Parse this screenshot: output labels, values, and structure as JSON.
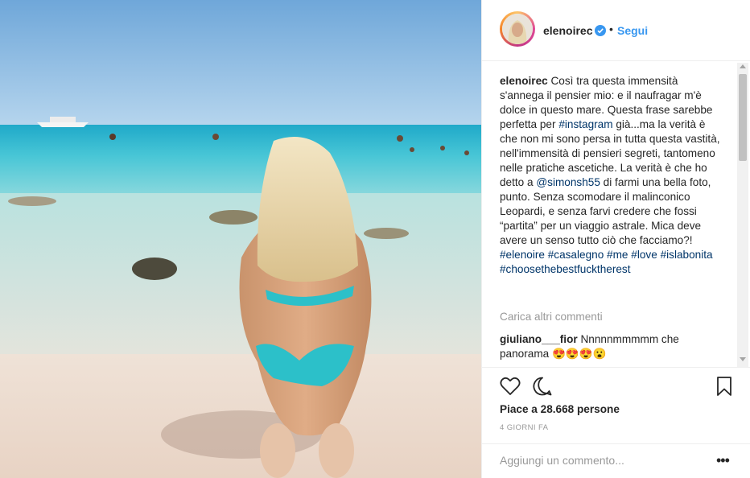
{
  "header": {
    "username": "elenoirec",
    "separator": "•",
    "follow_label": "Segui"
  },
  "caption": {
    "username": "elenoirec",
    "segments": [
      " Così tra questa immensità s'annega il pensier mio: e il naufragar m'è dolce in questo mare. Questa frase sarebbe perfetta per ",
      "#instagram",
      " già...ma la verità è che non mi sono persa in tutta questa vastità, nell'immensità di pensieri segreti, tantomeno nelle pratiche ascetiche. La verità è che ho detto a ",
      "@simonsh55",
      " di farmi una bella foto, punto. Senza scomodare il malinconico Leopardi, e senza farvi credere che fossi “partita” per un viaggio astrale. Mica deve avere un senso tutto ciò che facciamo?! ",
      "#elenoire",
      " ",
      "#casalegno",
      " ",
      "#me",
      " ",
      "#love",
      " ",
      "#islabonita",
      " ",
      "#choosethebestfucktherest"
    ]
  },
  "load_more": "Carica altri commenti",
  "comment": {
    "username": "giuliano___fior",
    "text": " Nnnnnmmmmm che panorama 😍😍😍😮"
  },
  "actions": {
    "icons": [
      "heart-icon",
      "comment-icon",
      "bookmark-icon"
    ],
    "likes": "Piace a 28.668 persone",
    "time": "4 GIORNI FA"
  },
  "add_comment": {
    "placeholder": "Aggiungi un commento...",
    "options": "•••"
  },
  "colors": {
    "link": "#003569",
    "follow": "#3897f0",
    "muted": "#999999",
    "text": "#262626"
  }
}
